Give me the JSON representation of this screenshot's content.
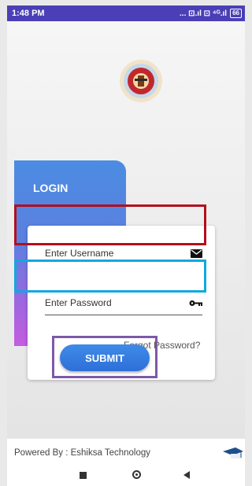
{
  "status_bar": {
    "time": "1:48 PM",
    "icons": "... ⊡.ıl ⊡ ⁴ᴳ.ıl",
    "battery": "66"
  },
  "login": {
    "title": "LOGIN",
    "username_placeholder": "Enter Username",
    "password_placeholder": "Enter Password",
    "forgot_link": "Forgot Password?",
    "submit_label": "SUBMIT"
  },
  "footer": {
    "powered_by": "Powered By : Eshiksa Technology"
  },
  "colors": {
    "status_bar": "#4a3fb6",
    "submit": "#2e6fd8",
    "highlight_username": "#b30e1d",
    "highlight_password": "#11a8e0",
    "highlight_submit": "#7c5aa6"
  }
}
